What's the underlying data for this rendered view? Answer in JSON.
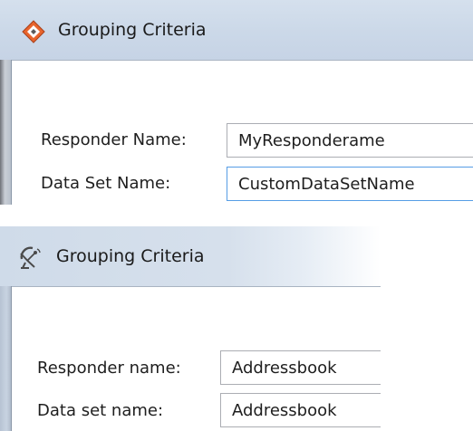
{
  "dialogs": [
    {
      "title": "Grouping Criteria",
      "icon": "eclipse-diamond-icon",
      "fields": [
        {
          "label": "Responder Name:",
          "value": "MyResponderame"
        },
        {
          "label": "Data Set Name:",
          "value": "CustomDataSetName"
        }
      ]
    },
    {
      "title": "Grouping Criteria",
      "icon": "satellite-dish-icon",
      "fields": [
        {
          "label": "Responder name:",
          "value": "Addressbook"
        },
        {
          "label": "Data set name:",
          "value": "Addressbook"
        }
      ]
    }
  ],
  "colors": {
    "titlebar": "#cbd8e8",
    "input_border": "#abadb3",
    "focus_border": "#569de5",
    "icon_orange": "#e8642c"
  }
}
